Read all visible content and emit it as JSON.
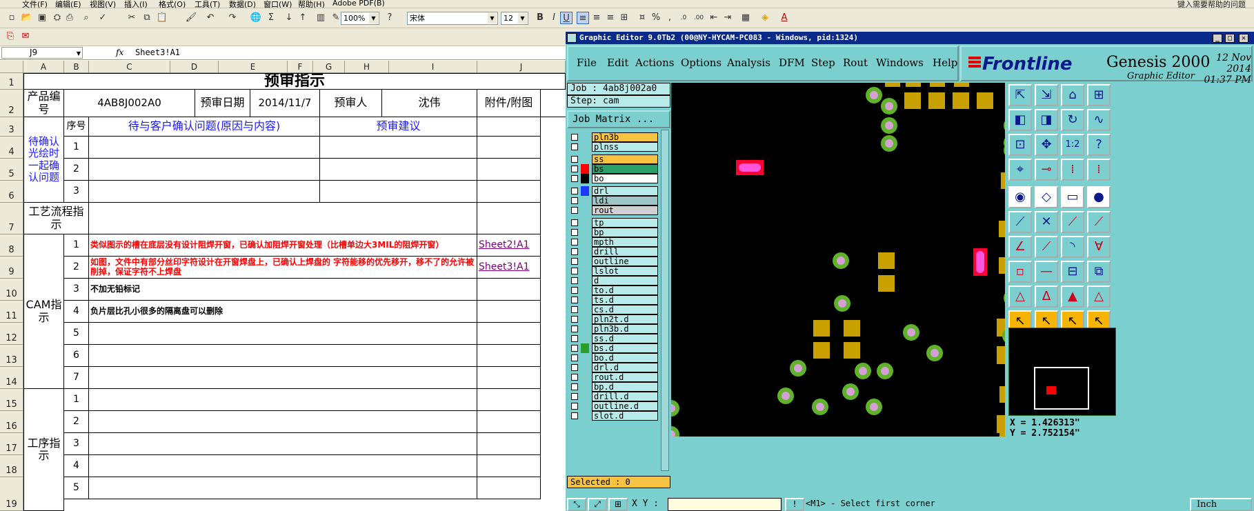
{
  "excel": {
    "menu": [
      "文件(F)",
      "编辑(E)",
      "视图(V)",
      "插入(I)",
      "格式(O)",
      "工具(T)",
      "数据(D)",
      "窗口(W)",
      "帮助(H)",
      "Adobe PDF(B)"
    ],
    "help_hint": "键入需要帮助的问题",
    "zoom": "100%",
    "font_name": "宋体",
    "font_size": "12",
    "name_box": "J9",
    "fx": "fx",
    "formula": "Sheet3!A1",
    "columns": [
      "A",
      "B",
      "C",
      "D",
      "E",
      "F",
      "G",
      "H",
      "I",
      "J"
    ],
    "rows": [
      "1",
      "2",
      "3",
      "4",
      "5",
      "6",
      "7",
      "8",
      "9",
      "10",
      "11",
      "12",
      "13",
      "14",
      "15",
      "16",
      "17",
      "18",
      "19"
    ],
    "sheet": {
      "title": "预审指示",
      "product_no_label": "产品编号",
      "product_no": "4AB8J002A0",
      "review_date_label": "预审日期",
      "review_date": "2014/11/7",
      "reviewer_label": "预审人",
      "reviewer": "沈伟",
      "attach_label": "附件/附图",
      "seq_label": "序号",
      "issue_header": "待与客户确认问题(原因与内容)",
      "suggest_header": "预审建议",
      "confirm_label": "待确认光绘时一起确认问题",
      "confirm_nums": [
        "1",
        "2",
        "3"
      ],
      "process_label": "工艺流程指示",
      "cam_label": "CAM指示",
      "cam_items": [
        {
          "n": "1",
          "text": "类似图示的槽在底层没有设计阻焊开窗，已确认加阻焊开窗处理（比槽单边大3MIL的阻焊开窗）",
          "link": "Sheet2!A1"
        },
        {
          "n": "2",
          "text": "如图，文件中有部分丝印字符设计在开窗焊盘上，已确认上焊盘的 字符能移的优先移开，移不了的允许被削掉，保证字符不上焊盘",
          "link": "Sheet3!A1"
        },
        {
          "n": "3",
          "text": "不加无铅标记",
          "link": ""
        },
        {
          "n": "4",
          "text": "负片层比孔小很多的隔离盘可以删除",
          "link": ""
        },
        {
          "n": "5",
          "text": "",
          "link": ""
        },
        {
          "n": "6",
          "text": "",
          "link": ""
        },
        {
          "n": "7",
          "text": "",
          "link": ""
        }
      ],
      "proc_label": "工序指示",
      "proc_nums": [
        "1",
        "2",
        "3",
        "4",
        "5"
      ]
    }
  },
  "genesis": {
    "title": "Graphic Editor 9.0Tb2 (00@NY-HYCAM-PC083 - Windows, pid:1324)",
    "menu": [
      "File",
      "Edit",
      "Actions",
      "Options",
      "Analysis",
      "DFM",
      "Step",
      "Rout",
      "Windows",
      "Help"
    ],
    "brand": "Frontline",
    "product": "Genesis 2000",
    "product_sub": "Graphic Editor",
    "date": "12 Nov 2014",
    "time": "01:37 PM",
    "job": "Job : 4ab8j002a0",
    "step": "Step: cam",
    "job_matrix": "Job Matrix ...",
    "layers": [
      {
        "name": "pln3b",
        "color": "#f5c242",
        "sw": ""
      },
      {
        "name": "plnss",
        "color": "#b9eaea",
        "sw": ""
      },
      {
        "name": "ss",
        "color": "#f5c242",
        "sw": ""
      },
      {
        "name": "bs",
        "color": "#2aa06a",
        "sw": "#ff0000"
      },
      {
        "name": "bo",
        "color": "#ffffff",
        "sw": "#000000"
      },
      {
        "name": "drl",
        "color": "#b9eaea",
        "sw": "#1a3aff"
      },
      {
        "name": "ldi",
        "color": "#9fc6c6",
        "sw": ""
      },
      {
        "name": "rout",
        "color": "#d0d0d0",
        "sw": ""
      },
      {
        "name": "tp",
        "color": "#b9eaea",
        "sw": ""
      },
      {
        "name": "bp",
        "color": "#b9eaea",
        "sw": ""
      },
      {
        "name": "mpth",
        "color": "#b9eaea",
        "sw": ""
      },
      {
        "name": "drill",
        "color": "#b9eaea",
        "sw": ""
      },
      {
        "name": "outline",
        "color": "#b9eaea",
        "sw": ""
      },
      {
        "name": "lslot",
        "color": "#b9eaea",
        "sw": ""
      },
      {
        "name": "d",
        "color": "#b9eaea",
        "sw": ""
      },
      {
        "name": "to.d",
        "color": "#b9eaea",
        "sw": ""
      },
      {
        "name": "ts.d",
        "color": "#b9eaea",
        "sw": ""
      },
      {
        "name": "cs.d",
        "color": "#b9eaea",
        "sw": ""
      },
      {
        "name": "pln2t.d",
        "color": "#b9eaea",
        "sw": ""
      },
      {
        "name": "pln3b.d",
        "color": "#b9eaea",
        "sw": ""
      },
      {
        "name": "ss.d",
        "color": "#b9eaea",
        "sw": ""
      },
      {
        "name": "bs.d",
        "color": "#b9eaea",
        "sw": "#2aa02a"
      },
      {
        "name": "bo.d",
        "color": "#b9eaea",
        "sw": ""
      },
      {
        "name": "drl.d",
        "color": "#b9eaea",
        "sw": ""
      },
      {
        "name": "rout.d",
        "color": "#b9eaea",
        "sw": ""
      },
      {
        "name": "bp.d",
        "color": "#b9eaea",
        "sw": ""
      },
      {
        "name": "drill.d",
        "color": "#b9eaea",
        "sw": ""
      },
      {
        "name": "outline.d",
        "color": "#b9eaea",
        "sw": ""
      },
      {
        "name": "slot.d",
        "color": "#b9eaea",
        "sw": ""
      }
    ],
    "selected": "Selected : 0",
    "coord_x": "X = 1.426313\"",
    "coord_y": "Y = 2.752154\"",
    "xy_label": "X Y :",
    "message": "<M1> - Select first corner",
    "unit": "Inch"
  }
}
